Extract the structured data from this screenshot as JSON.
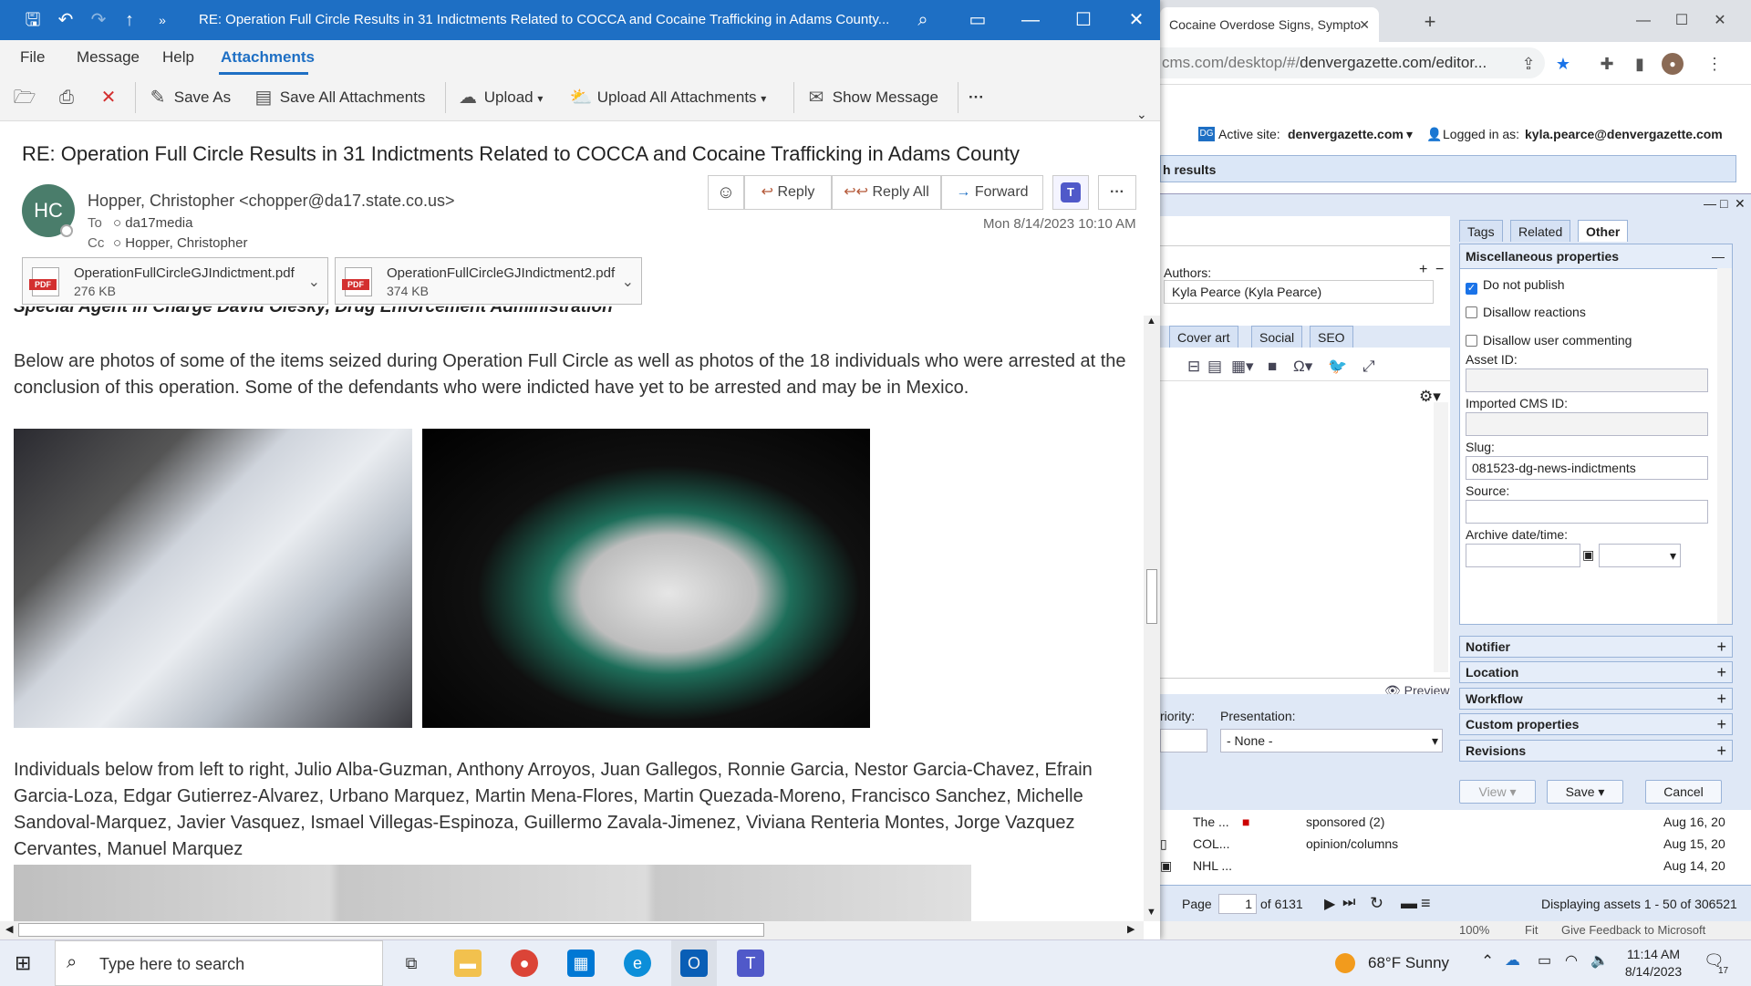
{
  "outlook": {
    "window_title": "RE: Operation Full Circle Results in 31 Indictments Related to COCCA and Cocaine Trafficking in Adams County...",
    "menu": [
      "File",
      "Message",
      "Help",
      "Attachments"
    ],
    "ribbon": {
      "save_as": "Save As",
      "save_all": "Save All Attachments",
      "upload": "Upload",
      "upload_all": "Upload All Attachments",
      "show_message": "Show Message"
    },
    "subject": "RE: Operation Full Circle Results in 31 Indictments Related to COCCA and Cocaine Trafficking in Adams County",
    "sender": {
      "initials": "HC",
      "display": "Hopper, Christopher <chopper@da17.state.co.us>"
    },
    "to_label": "To",
    "to_value": "da17media",
    "cc_label": "Cc",
    "cc_value": "Hopper, Christopher",
    "date": "Mon 8/14/2023 10:10 AM",
    "actions": {
      "reply": "Reply",
      "reply_all": "Reply All",
      "forward": "Forward"
    },
    "attachments": [
      {
        "name": "OperationFullCircleGJIndictment.pdf",
        "size": "276 KB",
        "type": "PDF"
      },
      {
        "name": "OperationFullCircleGJIndictment2.pdf",
        "size": "374 KB",
        "type": "PDF"
      }
    ],
    "body": {
      "cut_line": "Special Agent in Charge David Olesky, Drug Enforcement Administration",
      "paragraph1": "Below are photos of some of the items seized during Operation Full Circle as well as photos of the 18 individuals who were arrested at the conclusion of this operation. Some of the defendants who were indicted have yet to be arrested and may be in Mexico.",
      "paragraph2": "Individuals below from left to right, Julio Alba-Guzman, Anthony Arroyos, Juan Gallegos, Ronnie Garcia, Nestor Garcia-Chavez, Efrain Garcia-Loza, Edgar Gutierrez-Alvarez, Urbano Marquez, Martin Mena-Flores, Martin Quezada-Moreno, Francisco Sanchez, Michelle Sandoval-Marquez, Javier Vasquez, Ismael Villegas-Espinoza, Guillermo Zavala-Jimenez, Viviana Renteria Montes, Jorge Vazquez Cervantes, Manuel Marquez"
    }
  },
  "browser": {
    "tab_title": "Cocaine Overdose Signs, Sympto",
    "url_prefix": "cms.com/desktop/#/",
    "url_rest": "denvergazette.com/editor...",
    "colors": {
      "accent": "#1e6fc4"
    }
  },
  "cms": {
    "active_site_label": "Active site:",
    "active_site": "denvergazette.com",
    "logged_in_label": "Logged in as:",
    "logged_in_user": "kyla.pearce@denvergazette.com",
    "results_label": "h results",
    "authors_label": "Authors:",
    "author": "Kyla Pearce (Kyla Pearce)",
    "left_tabs": [
      "Cover art",
      "Social",
      "SEO"
    ],
    "preview": "Preview",
    "priority_label": "riority:",
    "presentation_label": "Presentation:",
    "presentation_value": "- None -",
    "right_tabs": [
      "Tags",
      "Related",
      "Other"
    ],
    "misc_title": "Miscellaneous properties",
    "do_not_publish": "Do not publish",
    "disallow_reactions": "Disallow reactions",
    "disallow_commenting": "Disallow user commenting",
    "asset_id_label": "Asset ID:",
    "imported_cms_label": "Imported CMS ID:",
    "slug_label": "Slug:",
    "slug_value": "081523-dg-news-indictments",
    "source_label": "Source:",
    "archive_label": "Archive date/time:",
    "sections": [
      "Notifier",
      "Location",
      "Workflow",
      "Custom properties",
      "Revisions"
    ],
    "buttons": {
      "view": "View",
      "save": "Save",
      "cancel": "Cancel"
    },
    "rows": [
      {
        "title": "The ...",
        "section": "sponsored (2)",
        "date": "Aug 16, 20"
      },
      {
        "title": "COL...",
        "section": "opinion/columns",
        "date": "Aug 15, 20"
      },
      {
        "title": "NHL ...",
        "section": "",
        "date": "Aug 14, 20"
      }
    ],
    "pager": {
      "page_label": "Page",
      "page": "1",
      "of": "of 6131",
      "displaying": "Displaying assets 1 - 50 of 306521"
    },
    "zoom": "100%",
    "fit": "Fit",
    "feedback": "Give Feedback to Microsoft"
  },
  "taskbar": {
    "search_placeholder": "Type here to search",
    "weather": "68°F  Sunny",
    "time": "11:14 AM",
    "date": "8/14/2023",
    "notifications": "17"
  }
}
